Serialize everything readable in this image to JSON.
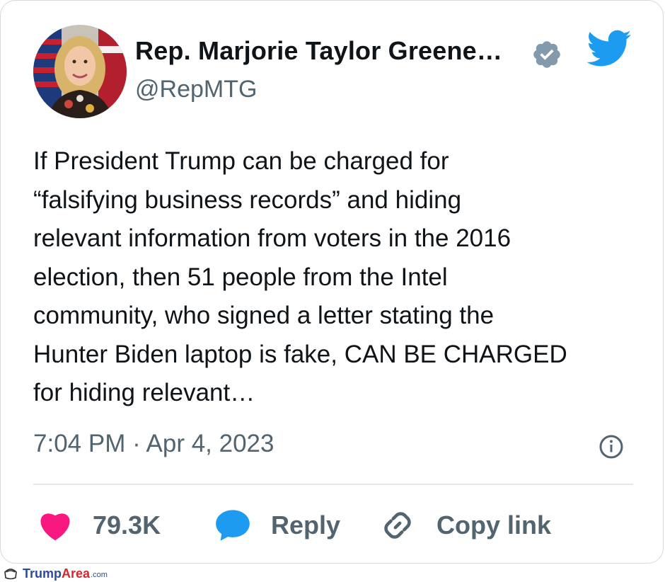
{
  "tweet": {
    "author_name": "Rep. Marjorie Taylor Greene…",
    "handle": "@RepMTG",
    "body_lines": [
      "If President Trump can be charged for",
      "“falsifying business records” and hiding",
      "relevant information from voters in the 2016",
      "election, then 51 people from the Intel",
      "community, who signed a letter stating the",
      "Hunter Biden laptop is fake, CAN BE CHARGED",
      "for hiding relevant…"
    ],
    "timestamp": "7:04 PM · Apr 4, 2023"
  },
  "actions": {
    "likes": "79.3K",
    "reply_label": "Reply",
    "copy_label": "Copy link"
  },
  "icons": {
    "avatar": "profile-photo",
    "verified": "verified-badge-icon",
    "bird": "twitter-bird-icon",
    "info": "info-icon",
    "heart": "heart-icon",
    "reply": "reply-bubble-icon",
    "copy": "link-icon"
  },
  "colors": {
    "text": "#0f1419",
    "secondary": "#536471",
    "twitter_blue": "#1d9bf0",
    "heart": "#f91880",
    "verified_gray": "#829aab"
  },
  "watermark": {
    "part1": "Trump",
    "part2": "Area",
    "part3": ".com"
  }
}
